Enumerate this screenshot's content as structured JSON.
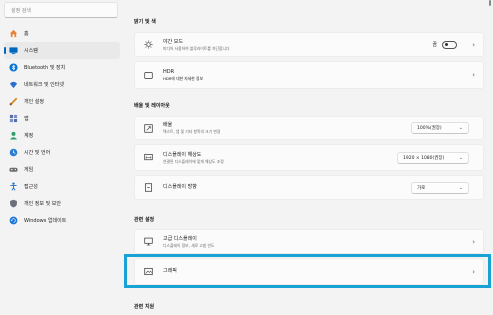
{
  "sidebar": {
    "search_placeholder": "설정 검색",
    "items": [
      {
        "label": "홈",
        "icon": "home-icon",
        "color": "#e8823a"
      },
      {
        "label": "시스템",
        "icon": "system-icon",
        "color": "#0067c0",
        "active": true
      },
      {
        "label": "Bluetooth 및 장치",
        "icon": "bluetooth-icon",
        "color": "#0a74d6"
      },
      {
        "label": "네트워크 및 인터넷",
        "icon": "network-icon",
        "color": "#2a6fcf"
      },
      {
        "label": "개인 설정",
        "icon": "personalization-icon",
        "color": "#d68a24"
      },
      {
        "label": "앱",
        "icon": "apps-icon",
        "color": "#5a6fa8"
      },
      {
        "label": "계정",
        "icon": "account-icon",
        "color": "#2e9e6b"
      },
      {
        "label": "시간 및 언어",
        "icon": "time-language-icon",
        "color": "#2b7cd3"
      },
      {
        "label": "게임",
        "icon": "gaming-icon",
        "color": "#6b6b6b"
      },
      {
        "label": "접근성",
        "icon": "accessibility-icon",
        "color": "#1f6fc5"
      },
      {
        "label": "개인 정보 및 보안",
        "icon": "privacy-shield-icon",
        "color": "#6b6f78"
      },
      {
        "label": "Windows 업데이트",
        "icon": "windows-update-icon",
        "color": "#1a73d6"
      }
    ]
  },
  "main": {
    "brightness_header": "밝기 및 색",
    "night_light": {
      "title": "야간 모드",
      "desc": "미디어 사용하여 블루라이트를 차단합니다",
      "toggle_label": "끔"
    },
    "hdr": {
      "title": "HDR",
      "desc": "HDR에 대한 자세한 정보"
    },
    "scale_header": "배율 및 레이아웃",
    "scale": {
      "title": "배율",
      "desc": "텍스트, 앱 및 기타 항목의 크기 변경",
      "value": "100%(권장)"
    },
    "resolution": {
      "title": "디스플레이 해상도",
      "desc": "연결된 디스플레이에 맞게 해상도 조정",
      "value": "1920 × 1080(권장)"
    },
    "orientation": {
      "title": "디스플레이 방향",
      "value": "가로"
    },
    "related_header": "관련 설정",
    "advanced": {
      "title": "고급 디스플레이",
      "desc": "디스플레이 정보, 새로 고침 빈도"
    },
    "graphics": {
      "title": "그래픽"
    },
    "support_header": "관련 지원"
  },
  "colors": {
    "accent": "#0067c0",
    "highlight": "#19a3d5"
  }
}
